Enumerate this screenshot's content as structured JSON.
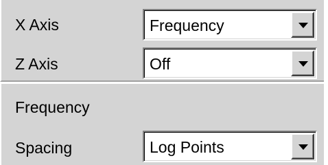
{
  "x_axis": {
    "label": "X Axis",
    "value": "Frequency",
    "icon": "chevron-down-icon"
  },
  "z_axis": {
    "label": "Z Axis",
    "value": "Off",
    "icon": "chevron-down-icon"
  },
  "frequency_section": {
    "heading": "Frequency",
    "spacing": {
      "label": "Spacing",
      "value": "Log Points",
      "icon": "chevron-down-icon"
    }
  },
  "colors": {
    "panel_bg": "#d4d4d4",
    "field_bg": "#ffffff",
    "text": "#000000"
  }
}
